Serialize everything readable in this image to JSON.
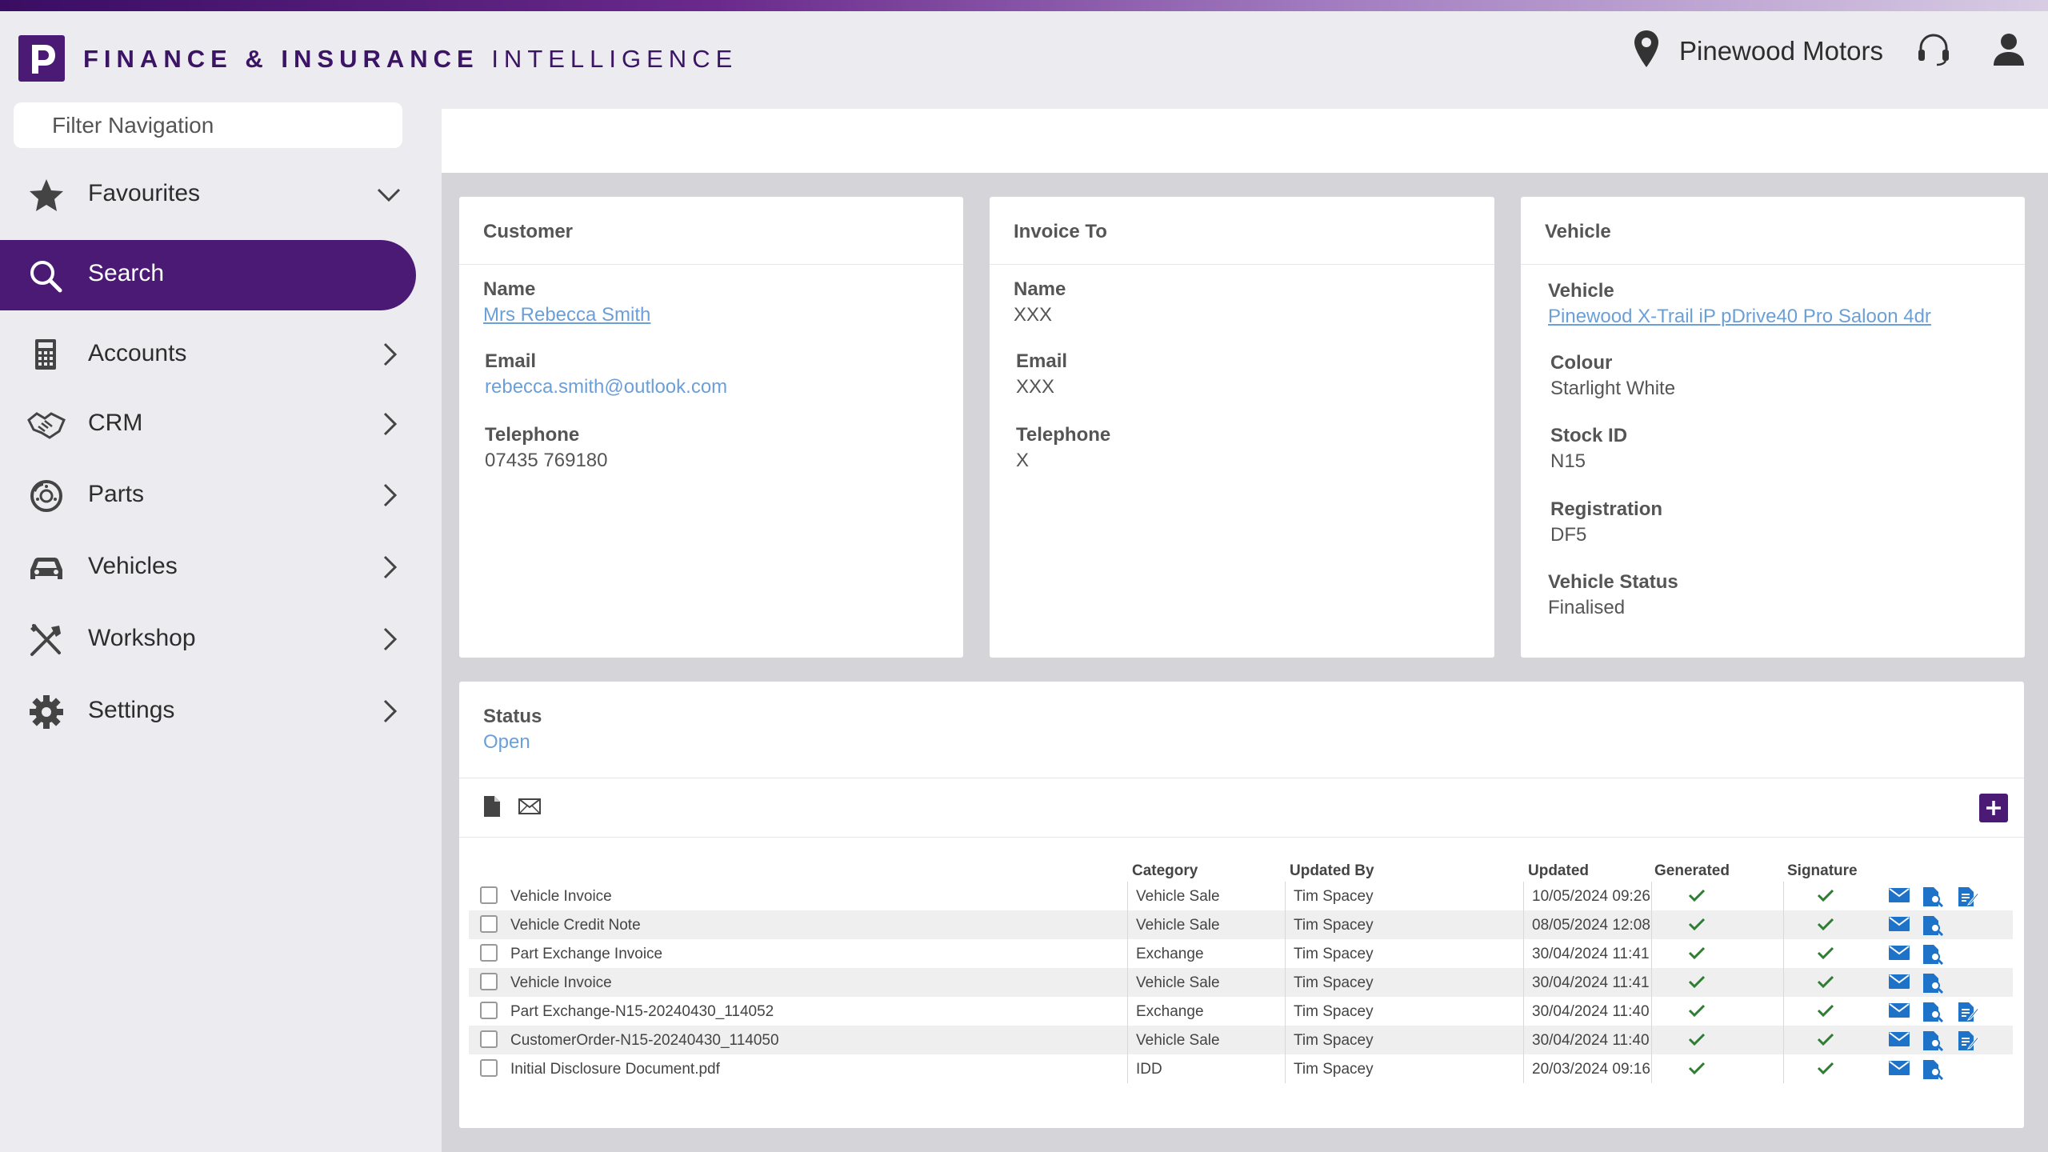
{
  "brand": {
    "bold": "FINANCE & INSURANCE",
    "light": "INTELLIGENCE",
    "logo_letter": "P",
    "accent": "#4a1a75"
  },
  "header": {
    "location": "Pinewood Motors"
  },
  "sidebar": {
    "filter_placeholder": "Filter Navigation",
    "items": [
      {
        "label": "Favourites",
        "icon": "star-icon"
      },
      {
        "label": "Search",
        "icon": "search-icon"
      },
      {
        "label": "Accounts",
        "icon": "calculator-icon"
      },
      {
        "label": "CRM",
        "icon": "handshake-icon"
      },
      {
        "label": "Parts",
        "icon": "brake-disc-icon"
      },
      {
        "label": "Vehicles",
        "icon": "car-icon"
      },
      {
        "label": "Workshop",
        "icon": "tools-icon"
      },
      {
        "label": "Settings",
        "icon": "gear-icon"
      }
    ]
  },
  "customer": {
    "title": "Customer",
    "name_label": "Name",
    "name": "Mrs Rebecca Smith",
    "email_label": "Email",
    "email": "rebecca.smith@outlook.com",
    "tel_label": "Telephone",
    "tel": "07435 769180"
  },
  "invoice_to": {
    "title": "Invoice To",
    "name_label": "Name",
    "name": "XXX",
    "email_label": "Email",
    "email": "XXX",
    "tel_label": "Telephone",
    "tel": "X"
  },
  "vehicle": {
    "title": "Vehicle",
    "vehicle_label": "Vehicle",
    "vehicle": "Pinewood X-Trail iP pDrive40 Pro Saloon 4dr",
    "colour_label": "Colour",
    "colour": "Starlight White",
    "stock_label": "Stock ID",
    "stock": "N15",
    "reg_label": "Registration",
    "reg": "DF5",
    "status_label": "Vehicle Status",
    "status": "Finalised"
  },
  "status": {
    "label": "Status",
    "value": "Open"
  },
  "table": {
    "headers": {
      "category": "Category",
      "updated_by": "Updated By",
      "updated": "Updated",
      "generated": "Generated",
      "signature": "Signature"
    },
    "rows": [
      {
        "name": "Vehicle Invoice",
        "category": "Vehicle Sale",
        "updated_by": "Tim Spacey",
        "updated": "10/05/2024 09:26",
        "edit": true
      },
      {
        "name": "Vehicle Credit Note",
        "category": "Vehicle Sale",
        "updated_by": "Tim Spacey",
        "updated": "08/05/2024 12:08",
        "edit": false
      },
      {
        "name": "Part Exchange Invoice",
        "category": "Exchange",
        "updated_by": "Tim Spacey",
        "updated": "30/04/2024 11:41",
        "edit": false
      },
      {
        "name": "Vehicle Invoice",
        "category": "Vehicle Sale",
        "updated_by": "Tim Spacey",
        "updated": "30/04/2024 11:41",
        "edit": false
      },
      {
        "name": "Part Exchange-N15-20240430_114052",
        "category": "Exchange",
        "updated_by": "Tim Spacey",
        "updated": "30/04/2024 11:40",
        "edit": true
      },
      {
        "name": "CustomerOrder-N15-20240430_114050",
        "category": "Vehicle Sale",
        "updated_by": "Tim Spacey",
        "updated": "30/04/2024 11:40",
        "edit": true
      },
      {
        "name": "Initial Disclosure Document.pdf",
        "category": "IDD",
        "updated_by": "Tim Spacey",
        "updated": "20/03/2024 09:16",
        "edit": false
      }
    ]
  }
}
